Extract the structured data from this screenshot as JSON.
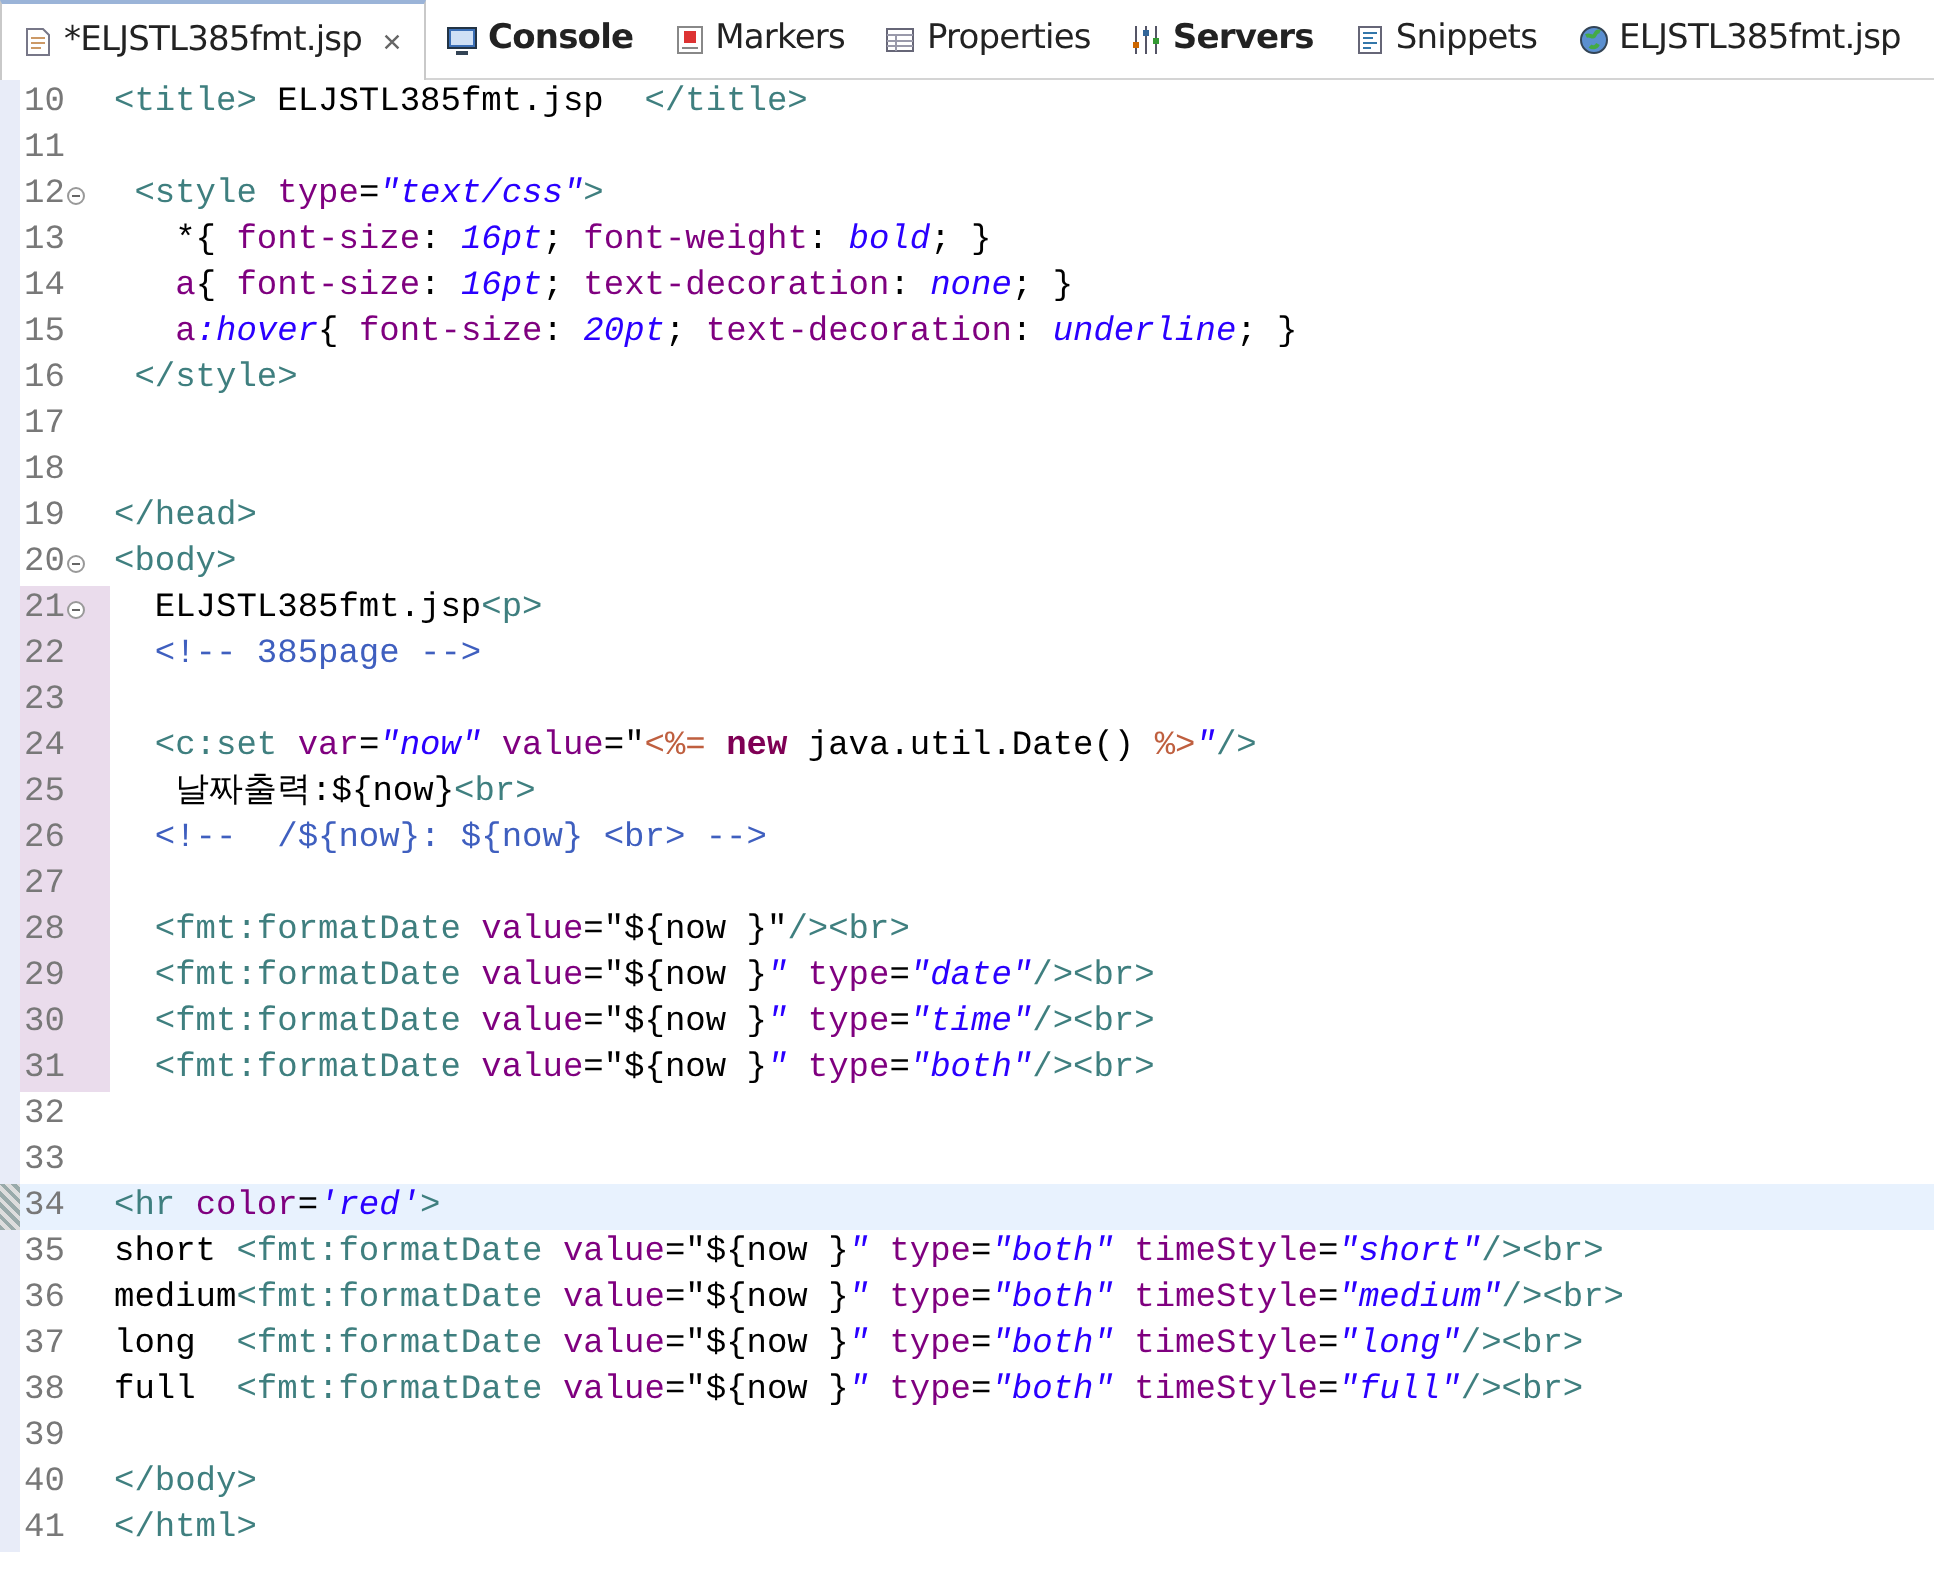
{
  "tabs": [
    {
      "kind": "editor",
      "label": "*ELJSTL385fmt.jsp",
      "selected": true,
      "bold": false,
      "closable": true
    },
    {
      "kind": "console",
      "label": "Console",
      "selected": false,
      "bold": true,
      "closable": false
    },
    {
      "kind": "markers",
      "label": "Markers",
      "selected": false,
      "bold": false,
      "closable": false
    },
    {
      "kind": "properties",
      "label": "Properties",
      "selected": false,
      "bold": false,
      "closable": false
    },
    {
      "kind": "servers",
      "label": "Servers",
      "selected": false,
      "bold": true,
      "closable": false
    },
    {
      "kind": "snippets",
      "label": "Snippets",
      "selected": false,
      "bold": false,
      "closable": false
    },
    {
      "kind": "browser",
      "label": "ELJSTL385fmt.jsp",
      "selected": false,
      "bold": false,
      "closable": false
    }
  ],
  "editor": {
    "lines": [
      {
        "number": "10",
        "fold": false,
        "changed": false,
        "current": false,
        "tokens": [
          {
            "kind": "tag",
            "text": "<title>"
          },
          {
            "kind": "text",
            "text": " ELJSTL385fmt.jsp  "
          },
          {
            "kind": "tag",
            "text": "</title>"
          }
        ]
      },
      {
        "number": "11",
        "fold": false,
        "changed": false,
        "current": false
      },
      {
        "number": "12",
        "fold": true,
        "changed": false,
        "current": false,
        "tokens": [
          {
            "kind": "tag",
            "text": " <style "
          },
          {
            "kind": "attr",
            "text": "type"
          },
          {
            "kind": "text",
            "text": "="
          },
          {
            "kind": "value",
            "text": "\"text/css\""
          },
          {
            "kind": "tag",
            "text": ">"
          }
        ]
      },
      {
        "number": "13",
        "fold": false,
        "changed": false,
        "current": false,
        "tokens": [
          {
            "kind": "text",
            "text": "   *{ "
          },
          {
            "kind": "attr",
            "text": "font-size"
          },
          {
            "kind": "text",
            "text": ": "
          },
          {
            "kind": "value",
            "text": "16pt"
          },
          {
            "kind": "text",
            "text": "; "
          },
          {
            "kind": "attr",
            "text": "font-weight"
          },
          {
            "kind": "text",
            "text": ": "
          },
          {
            "kind": "value",
            "text": "bold"
          },
          {
            "kind": "text",
            "text": "; }"
          }
        ]
      },
      {
        "number": "14",
        "fold": false,
        "changed": false,
        "current": false,
        "tokens": [
          {
            "kind": "attr",
            "text": "   a"
          },
          {
            "kind": "text",
            "text": "{ "
          },
          {
            "kind": "attr",
            "text": "font-size"
          },
          {
            "kind": "text",
            "text": ": "
          },
          {
            "kind": "value",
            "text": "16pt"
          },
          {
            "kind": "text",
            "text": "; "
          },
          {
            "kind": "attr",
            "text": "text-decoration"
          },
          {
            "kind": "text",
            "text": ": "
          },
          {
            "kind": "value",
            "text": "none"
          },
          {
            "kind": "text",
            "text": "; }"
          }
        ]
      },
      {
        "number": "15",
        "fold": false,
        "changed": false,
        "current": false,
        "tokens": [
          {
            "kind": "attr",
            "text": "   a"
          },
          {
            "kind": "value",
            "text": ":hover"
          },
          {
            "kind": "text",
            "text": "{ "
          },
          {
            "kind": "attr",
            "text": "font-size"
          },
          {
            "kind": "text",
            "text": ": "
          },
          {
            "kind": "value",
            "text": "20pt"
          },
          {
            "kind": "text",
            "text": "; "
          },
          {
            "kind": "attr",
            "text": "text-decoration"
          },
          {
            "kind": "text",
            "text": ": "
          },
          {
            "kind": "value",
            "text": "underline"
          },
          {
            "kind": "text",
            "text": "; }"
          }
        ]
      },
      {
        "number": "16",
        "fold": false,
        "changed": false,
        "current": false,
        "tokens": [
          {
            "kind": "tag",
            "text": " </style>"
          }
        ]
      },
      {
        "number": "17",
        "fold": false,
        "changed": false,
        "current": false
      },
      {
        "number": "18",
        "fold": false,
        "changed": false,
        "current": false
      },
      {
        "number": "19",
        "fold": false,
        "changed": false,
        "current": false,
        "tokens": [
          {
            "kind": "tag",
            "text": "</head>"
          }
        ]
      },
      {
        "number": "20",
        "fold": true,
        "changed": false,
        "current": false,
        "tokens": [
          {
            "kind": "tag",
            "text": "<body>"
          }
        ]
      },
      {
        "number": "21",
        "fold": true,
        "changed": true,
        "current": false,
        "tokens": [
          {
            "kind": "text",
            "text": "  ELJSTL385fmt.jsp"
          },
          {
            "kind": "tag",
            "text": "<p>"
          }
        ]
      },
      {
        "number": "22",
        "fold": false,
        "changed": true,
        "current": false,
        "tokens": [
          {
            "kind": "comment",
            "text": "  <!-- 385page -->"
          }
        ]
      },
      {
        "number": "23",
        "fold": false,
        "changed": true,
        "current": false
      },
      {
        "number": "24",
        "fold": false,
        "changed": true,
        "current": false,
        "tokens": [
          {
            "kind": "tag",
            "text": "  <c:set "
          },
          {
            "kind": "attr",
            "text": "var"
          },
          {
            "kind": "text",
            "text": "="
          },
          {
            "kind": "value",
            "text": "\"now\""
          },
          {
            "kind": "attr",
            "text": " value"
          },
          {
            "kind": "text",
            "text": "=\""
          },
          {
            "kind": "delim",
            "text": "<%="
          },
          {
            "kind": "keyword",
            "text": " new"
          },
          {
            "kind": "text",
            "text": " java.util.Date() "
          },
          {
            "kind": "delim",
            "text": "%>"
          },
          {
            "kind": "value",
            "text": "\""
          },
          {
            "kind": "tag",
            "text": "/>"
          }
        ]
      },
      {
        "number": "25",
        "fold": false,
        "changed": true,
        "current": false,
        "tokens": [
          {
            "kind": "text",
            "text": "   날짜출력:${now}"
          },
          {
            "kind": "tag",
            "text": "<br>"
          }
        ]
      },
      {
        "number": "26",
        "fold": false,
        "changed": true,
        "current": false,
        "tokens": [
          {
            "kind": "comment",
            "text": "  <!--  /${now}: ${now} <br> -->"
          }
        ]
      },
      {
        "number": "27",
        "fold": false,
        "changed": true,
        "current": false
      },
      {
        "number": "28",
        "fold": false,
        "changed": true,
        "current": false,
        "tokens": [
          {
            "kind": "tag",
            "text": "  <fmt:formatDate "
          },
          {
            "kind": "attr",
            "text": "value"
          },
          {
            "kind": "text",
            "text": "=\"${now }\""
          },
          {
            "kind": "tag",
            "text": "/><br>"
          }
        ]
      },
      {
        "number": "29",
        "fold": false,
        "changed": true,
        "current": false,
        "tokens": [
          {
            "kind": "tag",
            "text": "  <fmt:formatDate "
          },
          {
            "kind": "attr",
            "text": "value"
          },
          {
            "kind": "text",
            "text": "=\"${now }"
          },
          {
            "kind": "value",
            "text": "\""
          },
          {
            "kind": "attr",
            "text": " type"
          },
          {
            "kind": "text",
            "text": "="
          },
          {
            "kind": "value",
            "text": "\"date\""
          },
          {
            "kind": "tag",
            "text": "/><br>"
          }
        ]
      },
      {
        "number": "30",
        "fold": false,
        "changed": true,
        "current": false,
        "tokens": [
          {
            "kind": "tag",
            "text": "  <fmt:formatDate "
          },
          {
            "kind": "attr",
            "text": "value"
          },
          {
            "kind": "text",
            "text": "=\"${now }"
          },
          {
            "kind": "value",
            "text": "\""
          },
          {
            "kind": "attr",
            "text": " type"
          },
          {
            "kind": "text",
            "text": "="
          },
          {
            "kind": "value",
            "text": "\"time\""
          },
          {
            "kind": "tag",
            "text": "/><br>"
          }
        ]
      },
      {
        "number": "31",
        "fold": false,
        "changed": true,
        "current": false,
        "tokens": [
          {
            "kind": "tag",
            "text": "  <fmt:formatDate "
          },
          {
            "kind": "attr",
            "text": "value"
          },
          {
            "kind": "text",
            "text": "=\"${now }"
          },
          {
            "kind": "value",
            "text": "\""
          },
          {
            "kind": "attr",
            "text": " type"
          },
          {
            "kind": "text",
            "text": "="
          },
          {
            "kind": "value",
            "text": "\"both\""
          },
          {
            "kind": "tag",
            "text": "/><br>"
          }
        ]
      },
      {
        "number": "32",
        "fold": false,
        "changed": false,
        "current": false
      },
      {
        "number": "33",
        "fold": false,
        "changed": false,
        "current": false
      },
      {
        "number": "34",
        "fold": false,
        "changed": false,
        "current": true,
        "tokens": [
          {
            "kind": "tag",
            "text": "<hr "
          },
          {
            "kind": "attr",
            "text": "color"
          },
          {
            "kind": "text",
            "text": "="
          },
          {
            "kind": "value",
            "text": "'red'"
          },
          {
            "kind": "tag",
            "text": ">"
          }
        ]
      },
      {
        "number": "35",
        "fold": false,
        "changed": false,
        "current": false,
        "tokens": [
          {
            "kind": "text",
            "text": "short "
          },
          {
            "kind": "tag",
            "text": "<fmt:formatDate "
          },
          {
            "kind": "attr",
            "text": "value"
          },
          {
            "kind": "text",
            "text": "=\"${now }"
          },
          {
            "kind": "value",
            "text": "\""
          },
          {
            "kind": "attr",
            "text": " type"
          },
          {
            "kind": "text",
            "text": "="
          },
          {
            "kind": "value",
            "text": "\"both\""
          },
          {
            "kind": "attr",
            "text": " timeStyle"
          },
          {
            "kind": "text",
            "text": "="
          },
          {
            "kind": "value",
            "text": "\"short\""
          },
          {
            "kind": "tag",
            "text": "/><br>"
          }
        ]
      },
      {
        "number": "36",
        "fold": false,
        "changed": false,
        "current": false,
        "tokens": [
          {
            "kind": "text",
            "text": "medium"
          },
          {
            "kind": "tag",
            "text": "<fmt:formatDate "
          },
          {
            "kind": "attr",
            "text": "value"
          },
          {
            "kind": "text",
            "text": "=\"${now }"
          },
          {
            "kind": "value",
            "text": "\""
          },
          {
            "kind": "attr",
            "text": " type"
          },
          {
            "kind": "text",
            "text": "="
          },
          {
            "kind": "value",
            "text": "\"both\""
          },
          {
            "kind": "attr",
            "text": " timeStyle"
          },
          {
            "kind": "text",
            "text": "="
          },
          {
            "kind": "value",
            "text": "\"medium\""
          },
          {
            "kind": "tag",
            "text": "/><br>"
          }
        ]
      },
      {
        "number": "37",
        "fold": false,
        "changed": false,
        "current": false,
        "tokens": [
          {
            "kind": "text",
            "text": "long  "
          },
          {
            "kind": "tag",
            "text": "<fmt:formatDate "
          },
          {
            "kind": "attr",
            "text": "value"
          },
          {
            "kind": "text",
            "text": "=\"${now }"
          },
          {
            "kind": "value",
            "text": "\""
          },
          {
            "kind": "attr",
            "text": " type"
          },
          {
            "kind": "text",
            "text": "="
          },
          {
            "kind": "value",
            "text": "\"both\""
          },
          {
            "kind": "attr",
            "text": " timeStyle"
          },
          {
            "kind": "text",
            "text": "="
          },
          {
            "kind": "value",
            "text": "\"long\""
          },
          {
            "kind": "tag",
            "text": "/><br>"
          }
        ]
      },
      {
        "number": "38",
        "fold": false,
        "changed": false,
        "current": false,
        "tokens": [
          {
            "kind": "text",
            "text": "full  "
          },
          {
            "kind": "tag",
            "text": "<fmt:formatDate "
          },
          {
            "kind": "attr",
            "text": "value"
          },
          {
            "kind": "text",
            "text": "=\"${now }"
          },
          {
            "kind": "value",
            "text": "\""
          },
          {
            "kind": "attr",
            "text": " type"
          },
          {
            "kind": "text",
            "text": "="
          },
          {
            "kind": "value",
            "text": "\"both\""
          },
          {
            "kind": "attr",
            "text": " timeStyle"
          },
          {
            "kind": "text",
            "text": "="
          },
          {
            "kind": "value",
            "text": "\"full\""
          },
          {
            "kind": "tag",
            "text": "/><br>"
          }
        ]
      },
      {
        "number": "39",
        "fold": false,
        "changed": false,
        "current": false
      },
      {
        "number": "40",
        "fold": false,
        "changed": false,
        "current": false,
        "tokens": [
          {
            "kind": "tag",
            "text": "</body>"
          }
        ]
      },
      {
        "number": "41",
        "fold": false,
        "changed": false,
        "current": false,
        "tokens": [
          {
            "kind": "tag",
            "text": "</html>"
          }
        ]
      }
    ]
  }
}
